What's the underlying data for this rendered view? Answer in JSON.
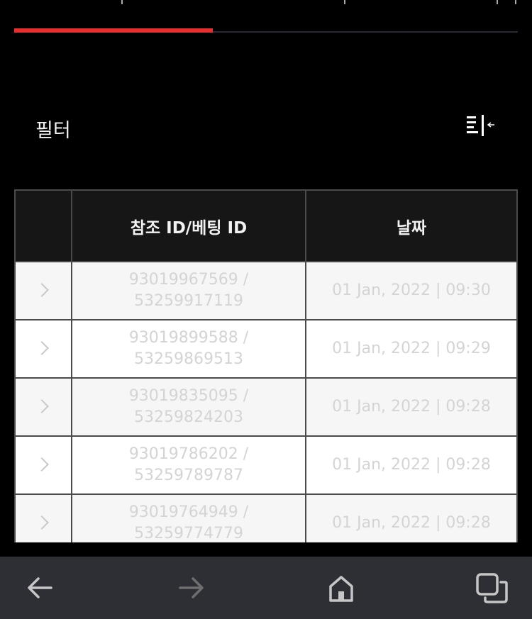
{
  "tabs": {
    "active_progress": 0.394
  },
  "filter": {
    "label": "필터",
    "toggle_icon": "filter-panel-icon"
  },
  "table": {
    "headers": [
      "",
      "참조 ID/베팅 ID",
      "날짜"
    ],
    "rows": [
      {
        "ids": "93019967569 / 53259917119",
        "date": "01 Jan, 2022 | 09:30"
      },
      {
        "ids": "93019899588 / 53259869513",
        "date": "01 Jan, 2022 | 09:29"
      },
      {
        "ids": "93019835095 / 53259824203",
        "date": "01 Jan, 2022 | 09:28"
      },
      {
        "ids": "93019786202 / 53259789787",
        "date": "01 Jan, 2022 | 09:28"
      },
      {
        "ids": "93019764949 / 53259774779",
        "date": "01 Jan, 2022 | 09:28"
      }
    ]
  },
  "colors": {
    "accent": "#e63030",
    "background": "#000000",
    "nav_bar": "#2e2f35"
  },
  "browser_nav": {
    "icons": [
      "back-arrow-icon",
      "forward-arrow-icon",
      "home-icon",
      "tabs-icon"
    ]
  }
}
